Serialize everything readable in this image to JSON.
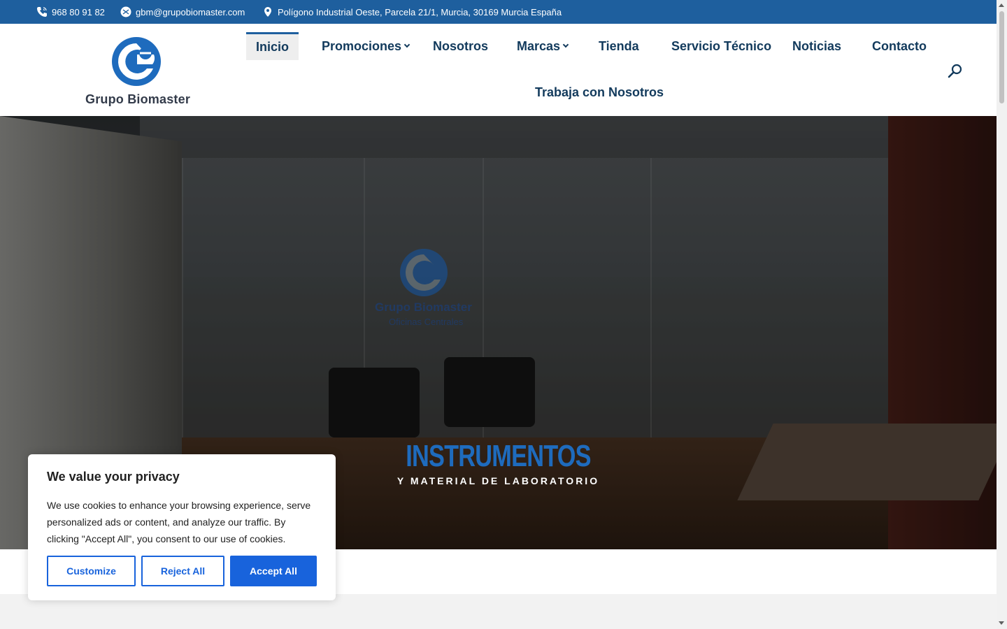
{
  "topbar": {
    "phone": "968 80 91 82",
    "email": "gbm@grupobiomaster.com",
    "address": "Polígono Industrial Oeste, Parcela 21/1, Murcia, 30169 Murcia España"
  },
  "header": {
    "logo_text": "Grupo Biomaster",
    "nav": [
      {
        "label": "Inicio"
      },
      {
        "label": "Promociones"
      },
      {
        "label": "Nosotros"
      },
      {
        "label": "Marcas"
      },
      {
        "label": "Tienda"
      },
      {
        "label": "Servicio Técnico"
      },
      {
        "label": "Noticias"
      },
      {
        "label": "Contacto"
      },
      {
        "label": "Trabaja con Nosotros"
      }
    ]
  },
  "hero": {
    "sign_title": "Grupo Biomaster",
    "sign_subtitle": "Oficinas Centrales",
    "title": "INSTRUMENTOS",
    "subtitle": "Y MATERIAL DE LABORATORIO"
  },
  "cookie": {
    "title": "We value your privacy",
    "text": "We use cookies to enhance your browsing experience, serve personalized ads or content, and analyze our traffic. By clicking \"Accept All\", you consent to our use of cookies.",
    "customize": "Customize",
    "reject": "Reject All",
    "accept": "Accept All"
  },
  "colors": {
    "brand_blue": "#1e5f9e",
    "nav_text": "#123a5c",
    "cookie_accent": "#1863dc"
  }
}
